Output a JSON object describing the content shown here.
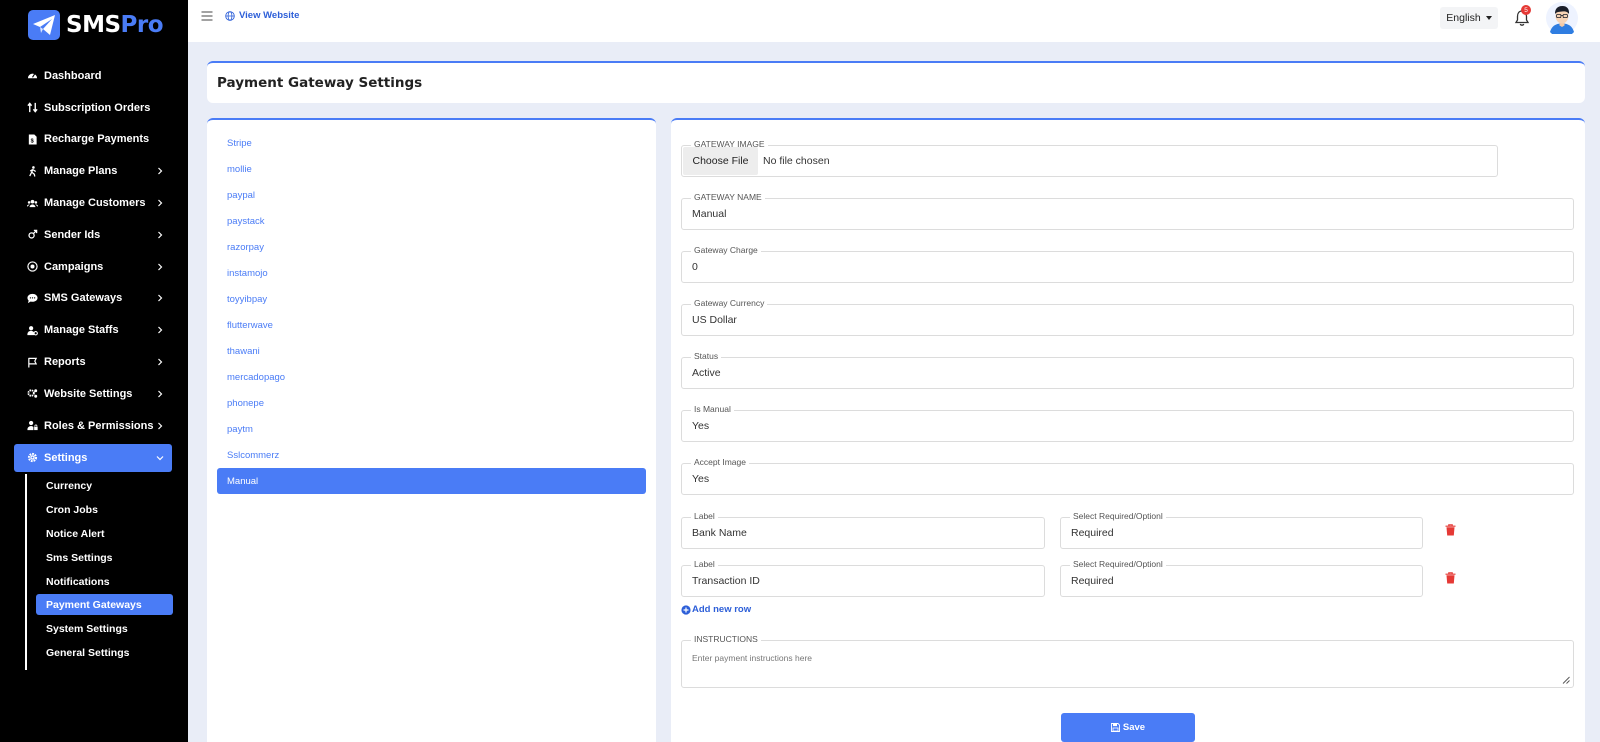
{
  "brand": {
    "name_a": "SMS",
    "name_b": "Pro"
  },
  "sidebar": {
    "items": [
      {
        "label": "Dashboard",
        "has_chevron": false
      },
      {
        "label": "Subscription Orders",
        "has_chevron": false
      },
      {
        "label": "Recharge Payments",
        "has_chevron": false
      },
      {
        "label": "Manage Plans",
        "has_chevron": true
      },
      {
        "label": "Manage Customers",
        "has_chevron": true
      },
      {
        "label": "Sender Ids",
        "has_chevron": true
      },
      {
        "label": "Campaigns",
        "has_chevron": true
      },
      {
        "label": "SMS Gateways",
        "has_chevron": true
      },
      {
        "label": "Manage Staffs",
        "has_chevron": true
      },
      {
        "label": "Reports",
        "has_chevron": true
      },
      {
        "label": "Website Settings",
        "has_chevron": true
      },
      {
        "label": "Roles & Permissions",
        "has_chevron": true
      },
      {
        "label": "Settings",
        "has_chevron": true,
        "active": true
      }
    ],
    "sub_items": [
      {
        "label": "Currency"
      },
      {
        "label": "Cron Jobs"
      },
      {
        "label": "Notice Alert"
      },
      {
        "label": "Sms Settings"
      },
      {
        "label": "Notifications"
      },
      {
        "label": "Payment Gateways",
        "active": true
      },
      {
        "label": "System Settings"
      },
      {
        "label": "General Settings"
      }
    ]
  },
  "topbar": {
    "view_website": "View Website",
    "language": "English",
    "notification_count": "5"
  },
  "page": {
    "title": "Payment Gateway Settings"
  },
  "gateways": [
    "Stripe",
    "mollie",
    "paypal",
    "paystack",
    "razorpay",
    "instamojo",
    "toyyibpay",
    "flutterwave",
    "thawani",
    "mercadopago",
    "phonepe",
    "paytm",
    "Sslcommerz",
    "Manual"
  ],
  "active_gateway": "Manual",
  "form": {
    "gateway_image": {
      "label": "GATEWAY IMAGE",
      "button": "Choose File",
      "status": "No file chosen"
    },
    "gateway_name": {
      "label": "GATEWAY NAME",
      "value": "Manual"
    },
    "gateway_charge": {
      "label": "Gateway Charge",
      "value": "0"
    },
    "gateway_currency": {
      "label": "Gateway Currency",
      "value": "US Dollar"
    },
    "status": {
      "label": "Status",
      "value": "Active"
    },
    "is_manual": {
      "label": "Is Manual",
      "value": "Yes"
    },
    "accept_image": {
      "label": "Accept Image",
      "value": "Yes"
    },
    "rows": [
      {
        "label_title": "Label",
        "label_value": "Bank Name",
        "req_title": "Select Required/Optionl",
        "req_value": "Required"
      },
      {
        "label_title": "Label",
        "label_value": "Transaction ID",
        "req_title": "Select Required/Optionl",
        "req_value": "Required"
      }
    ],
    "add_row": "Add new row",
    "instructions": {
      "label": "INSTRUCTIONS",
      "placeholder": "Enter payment instructions here"
    },
    "save": "Save"
  },
  "colors": {
    "accent": "#4a7cf6",
    "danger": "#e53935",
    "sidebar_bg": "#000000"
  }
}
